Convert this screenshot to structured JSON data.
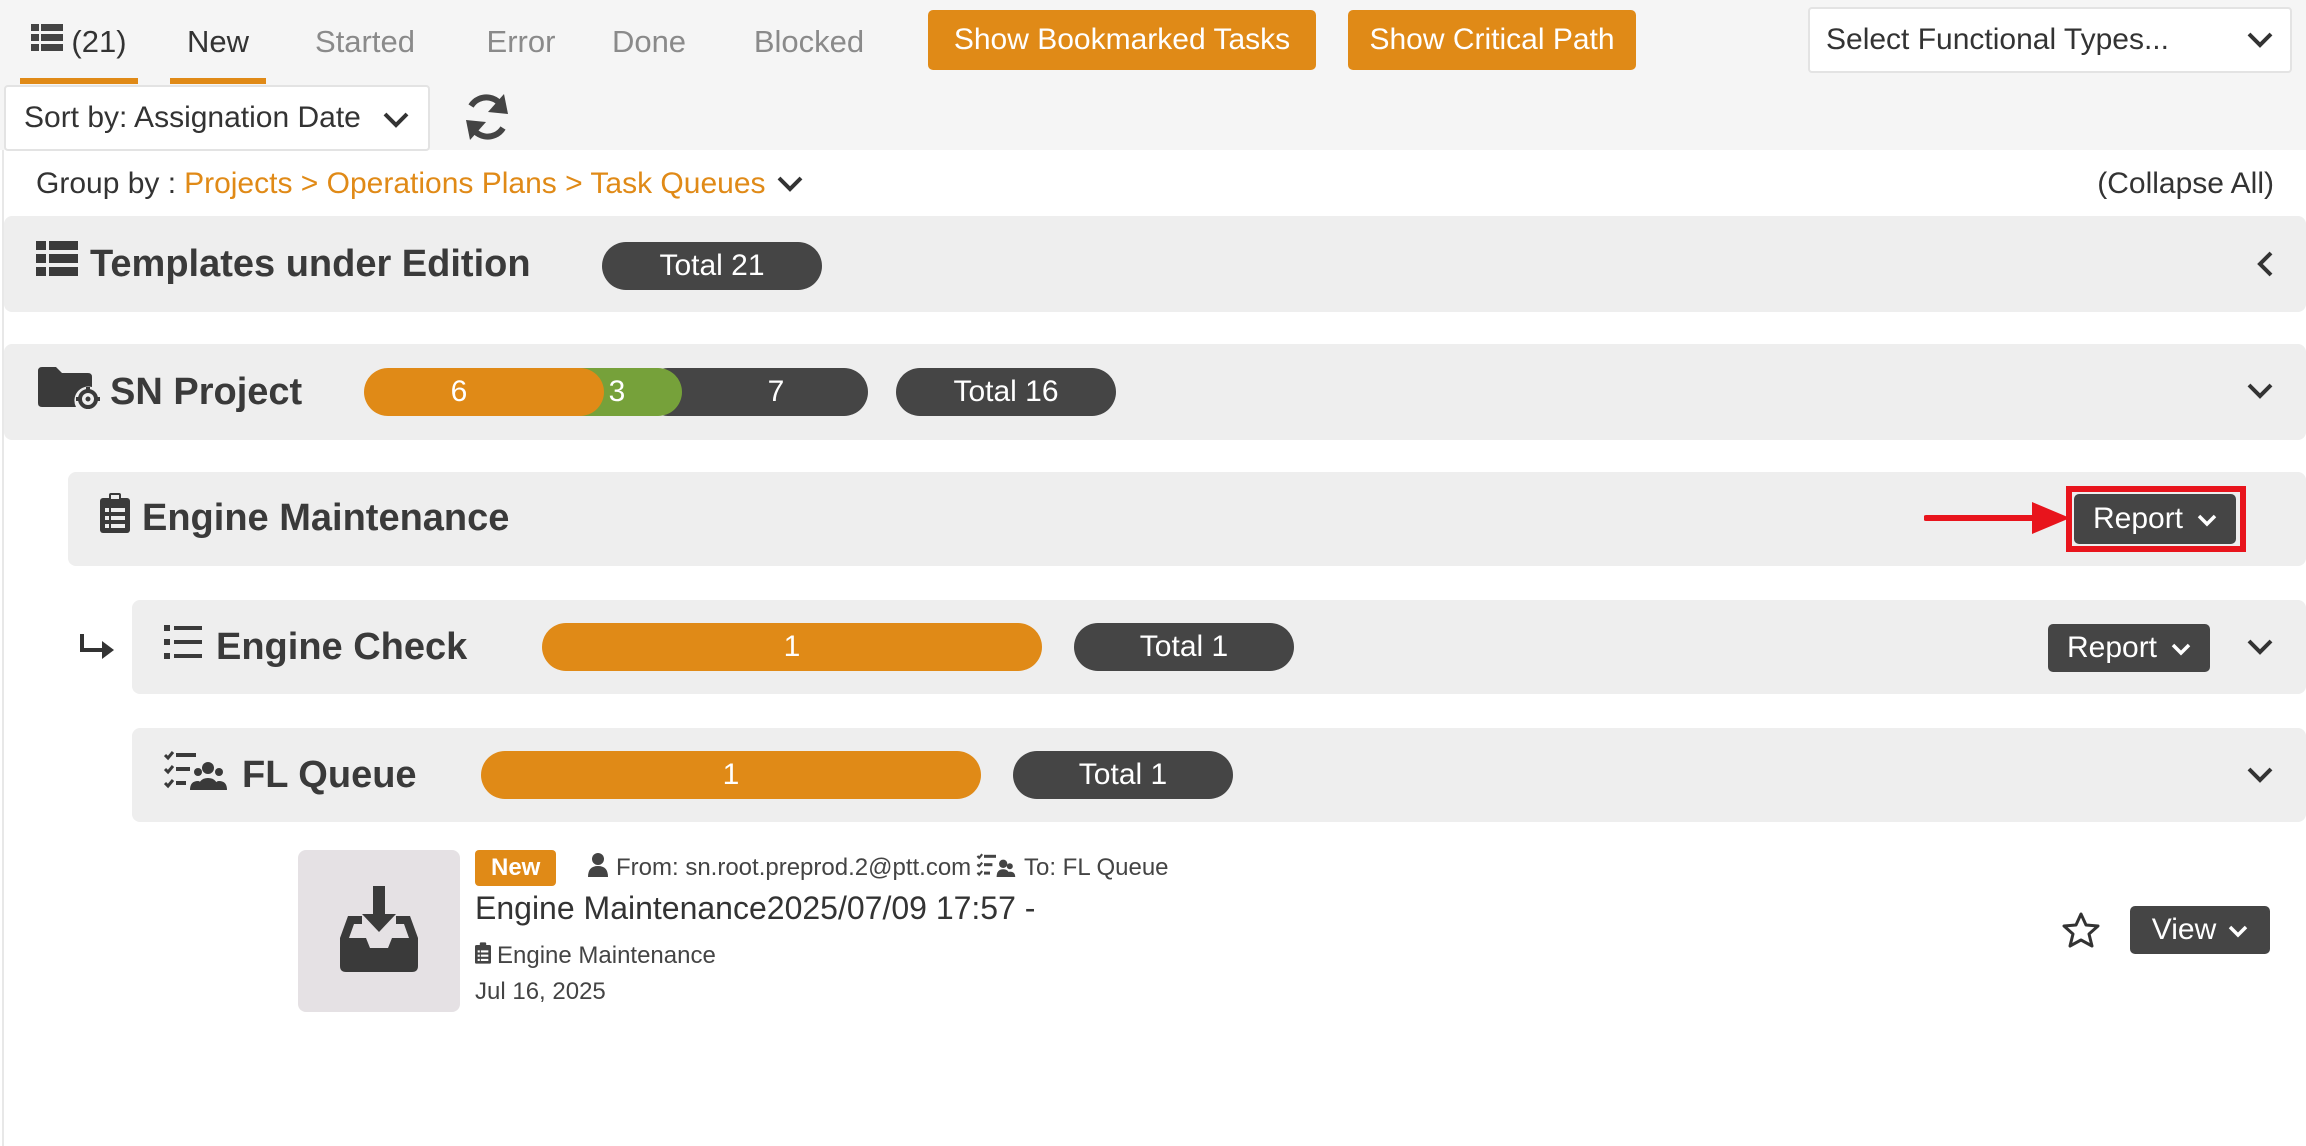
{
  "tabs": {
    "count_label": "(21)",
    "new": "New",
    "started": "Started",
    "error": "Error",
    "done": "Done",
    "blocked": "Blocked"
  },
  "toolbar": {
    "bookmarked_button": "Show Bookmarked Tasks",
    "critical_path_button": "Show Critical Path",
    "functional_types_select": "Select Functional Types...",
    "sort_select": "Sort by: Assignation Date"
  },
  "groupby": {
    "label": "Group by :",
    "path": "Projects > Operations Plans > Task Queues",
    "collapse_all": "(Collapse All)"
  },
  "templates_group": {
    "title": "Templates under Edition",
    "total": "Total 21"
  },
  "project": {
    "title": "SN Project",
    "count_orange": "6",
    "count_green": "3",
    "count_dark": "7",
    "total": "Total 16"
  },
  "plan": {
    "title": "Engine Maintenance",
    "report_button": "Report"
  },
  "check": {
    "title": "Engine Check",
    "count_orange": "1",
    "total": "Total 1",
    "report_button": "Report"
  },
  "queue": {
    "title": "FL Queue",
    "count_orange": "1",
    "total": "Total 1"
  },
  "task": {
    "status": "New",
    "from": "From: sn.root.preprod.2@ptt.com",
    "to": "To: FL Queue",
    "title": "Engine Maintenance2025/07/09 17:57 -",
    "plan": "Engine Maintenance",
    "date": "Jul 16, 2025",
    "view_button": "View"
  },
  "colors": {
    "accent": "#e08a17",
    "dark": "#454545",
    "green": "#76a13a",
    "annotation_red": "#e8141c"
  }
}
